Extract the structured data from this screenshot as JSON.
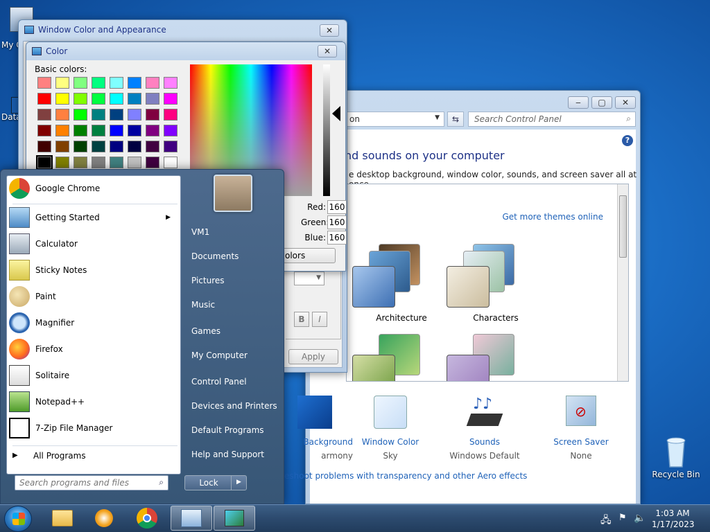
{
  "desktop": {
    "icons": [
      {
        "label": "My C",
        "name": "my-computer-icon"
      },
      {
        "label": "Data",
        "name": "data-icon"
      },
      {
        "label": "Recycle Bin",
        "name": "recycle-bin-icon"
      }
    ]
  },
  "control_panel": {
    "address_text": "on",
    "search_placeholder": "Search Control Panel",
    "heading": "nd sounds on your computer",
    "subheading": "e desktop background, window color, sounds, and screen saver all at once.",
    "more_themes_link": "Get more themes online",
    "themes": [
      {
        "name": "Architecture"
      },
      {
        "name": "Characters"
      }
    ],
    "options": [
      {
        "label": "Background",
        "value": "armony"
      },
      {
        "label": "Window Color",
        "value": "Sky"
      },
      {
        "label": "Sounds",
        "value": "Windows Default"
      },
      {
        "label": "Screen Saver",
        "value": "None"
      }
    ],
    "trouble_link": "eshoot problems with transparency and other Aero effects"
  },
  "window_color": {
    "title": "Window Color and Appearance",
    "apply_label": "Apply",
    "bold_label": "B",
    "italic_label": "I"
  },
  "color_dialog": {
    "title": "Color",
    "basic_colors_label": "Basic colors:",
    "swatches": [
      "#ff8080",
      "#ffff80",
      "#80ff80",
      "#00ff80",
      "#80ffff",
      "#0080ff",
      "#ff80c0",
      "#ff80ff",
      "#ff0000",
      "#ffff00",
      "#80ff00",
      "#00ff40",
      "#00ffff",
      "#0080c0",
      "#8080c0",
      "#ff00ff",
      "#804040",
      "#ff8040",
      "#00ff00",
      "#008080",
      "#004080",
      "#8080ff",
      "#800040",
      "#ff0080",
      "#800000",
      "#ff8000",
      "#008000",
      "#008040",
      "#0000ff",
      "#0000a0",
      "#800080",
      "#8000ff",
      "#400000",
      "#804000",
      "#004000",
      "#004040",
      "#000080",
      "#000040",
      "#400040",
      "#400080",
      "#000000",
      "#808000",
      "#808040",
      "#808080",
      "#408080",
      "#c0c0c0",
      "#400040",
      "#ffffff"
    ],
    "red_label": "Red:",
    "red_value": "160",
    "green_label": "Green:",
    "green_value": "160",
    "blue_label": "Blue:",
    "blue_value": "160",
    "define_button": "olors"
  },
  "start_menu": {
    "programs": [
      {
        "label": "Google Chrome",
        "name": "google-chrome",
        "submenu": false
      },
      {
        "label": "Getting Started",
        "name": "getting-started",
        "submenu": true
      },
      {
        "label": "Calculator",
        "name": "calculator",
        "submenu": false
      },
      {
        "label": "Sticky Notes",
        "name": "sticky-notes",
        "submenu": false
      },
      {
        "label": "Paint",
        "name": "paint",
        "submenu": false
      },
      {
        "label": "Magnifier",
        "name": "magnifier",
        "submenu": false
      },
      {
        "label": "Firefox",
        "name": "firefox",
        "submenu": false
      },
      {
        "label": "Solitaire",
        "name": "solitaire",
        "submenu": false
      },
      {
        "label": "Notepad++",
        "name": "notepad-plus-plus",
        "submenu": false
      },
      {
        "label": "7-Zip File Manager",
        "name": "7zip",
        "submenu": false
      }
    ],
    "all_programs": "All Programs",
    "search_placeholder": "Search programs and files",
    "right_items": [
      {
        "label": "VM1"
      },
      {
        "label": "Documents"
      },
      {
        "label": "Pictures"
      },
      {
        "label": "Music"
      },
      {
        "label": "Games"
      },
      {
        "label": "My Computer"
      },
      {
        "label": "Control Panel"
      },
      {
        "label": "Devices and Printers"
      },
      {
        "label": "Default Programs"
      },
      {
        "label": "Help and Support"
      }
    ],
    "lock_label": "Lock"
  },
  "taskbar": {
    "time": "1:03 AM",
    "date": "1/17/2023"
  }
}
